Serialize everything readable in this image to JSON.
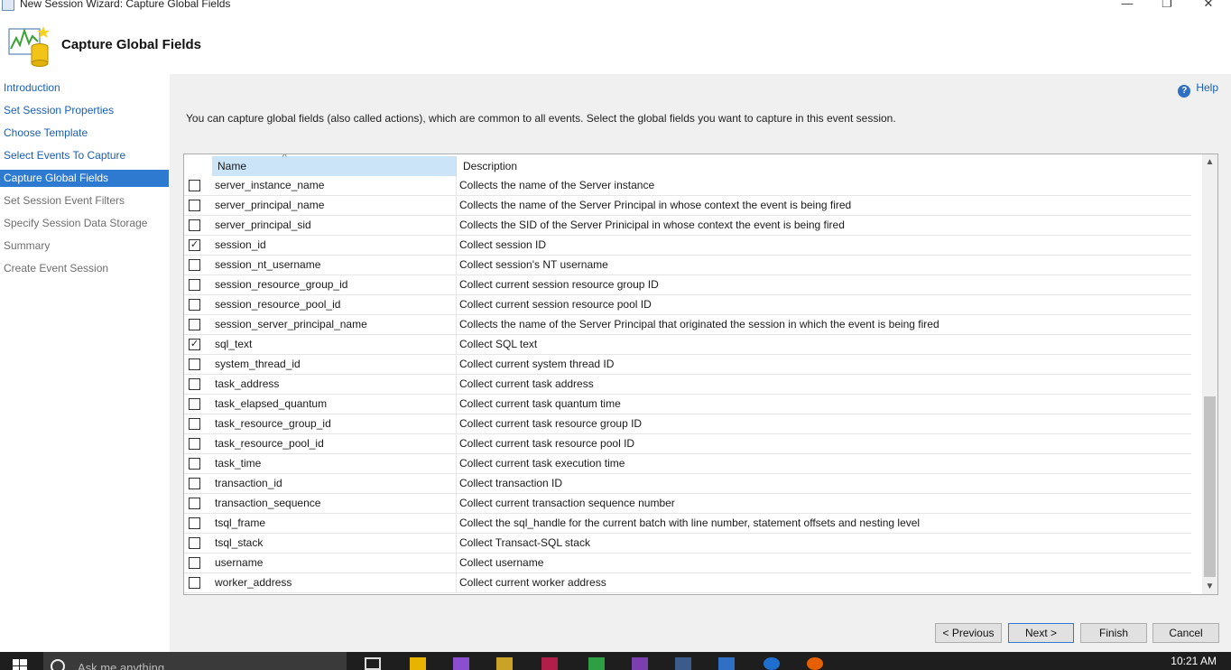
{
  "window": {
    "title": "New Session Wizard: Capture Global Fields",
    "minimize_glyph": "—",
    "maximize_glyph": "❐",
    "close_glyph": "✕"
  },
  "header": {
    "title": "Capture Global Fields",
    "logo_icon": "session-wizard-logo-icon"
  },
  "sidebar": {
    "items": [
      {
        "label": "Introduction",
        "state": "link"
      },
      {
        "label": "Set Session Properties",
        "state": "link"
      },
      {
        "label": "Choose Template",
        "state": "link"
      },
      {
        "label": "Select Events To Capture",
        "state": "link"
      },
      {
        "label": "Capture Global Fields",
        "state": "active"
      },
      {
        "label": "Set Session Event Filters",
        "state": "dim"
      },
      {
        "label": "Specify Session Data Storage",
        "state": "dim"
      },
      {
        "label": "Summary",
        "state": "dim"
      },
      {
        "label": "Create Event Session",
        "state": "dim"
      }
    ]
  },
  "help": {
    "label": "Help",
    "glyph": "?"
  },
  "instructions": "You can capture global fields (also called actions), which are common to all events. Select the global fields you want to capture in this event session.",
  "grid": {
    "columns": {
      "name": "Name",
      "description": "Description",
      "sort_glyph": "^"
    },
    "check_glyph": "✓",
    "rows": [
      {
        "name": "server_instance_name",
        "description": "Collects the name of the Server instance",
        "checked": false
      },
      {
        "name": "server_principal_name",
        "description": "Collects the name of the Server Principal in whose context the event is being fired",
        "checked": false
      },
      {
        "name": "server_principal_sid",
        "description": "Collects the SID of the Server Prinicipal in whose context the event is being fired",
        "checked": false
      },
      {
        "name": "session_id",
        "description": "Collect session ID",
        "checked": true
      },
      {
        "name": "session_nt_username",
        "description": "Collect session's NT username",
        "checked": false
      },
      {
        "name": "session_resource_group_id",
        "description": "Collect current session resource group ID",
        "checked": false
      },
      {
        "name": "session_resource_pool_id",
        "description": "Collect current session resource pool ID",
        "checked": false
      },
      {
        "name": "session_server_principal_name",
        "description": "Collects the name of the Server Principal that originated the session in which the event is being fired",
        "checked": false
      },
      {
        "name": "sql_text",
        "description": "Collect SQL text",
        "checked": true
      },
      {
        "name": "system_thread_id",
        "description": "Collect current system thread ID",
        "checked": false
      },
      {
        "name": "task_address",
        "description": "Collect current task address",
        "checked": false
      },
      {
        "name": "task_elapsed_quantum",
        "description": "Collect current task quantum time",
        "checked": false
      },
      {
        "name": "task_resource_group_id",
        "description": "Collect current task resource group ID",
        "checked": false
      },
      {
        "name": "task_resource_pool_id",
        "description": "Collect current task resource pool ID",
        "checked": false
      },
      {
        "name": "task_time",
        "description": "Collect current task execution time",
        "checked": false
      },
      {
        "name": "transaction_id",
        "description": "Collect transaction ID",
        "checked": false
      },
      {
        "name": "transaction_sequence",
        "description": "Collect current transaction sequence number",
        "checked": false
      },
      {
        "name": "tsql_frame",
        "description": "Collect the sql_handle for the current batch with line number, statement offsets and nesting level",
        "checked": false
      },
      {
        "name": "tsql_stack",
        "description": "Collect Transact-SQL stack",
        "checked": false
      },
      {
        "name": "username",
        "description": "Collect username",
        "checked": false
      },
      {
        "name": "worker_address",
        "description": "Collect current worker address",
        "checked": false
      }
    ]
  },
  "buttons": {
    "previous": "< Previous",
    "next": "Next >",
    "finish": "Finish",
    "cancel": "Cancel"
  },
  "taskbar": {
    "search_placeholder": "Ask me anything",
    "clock": "10:21 AM"
  }
}
